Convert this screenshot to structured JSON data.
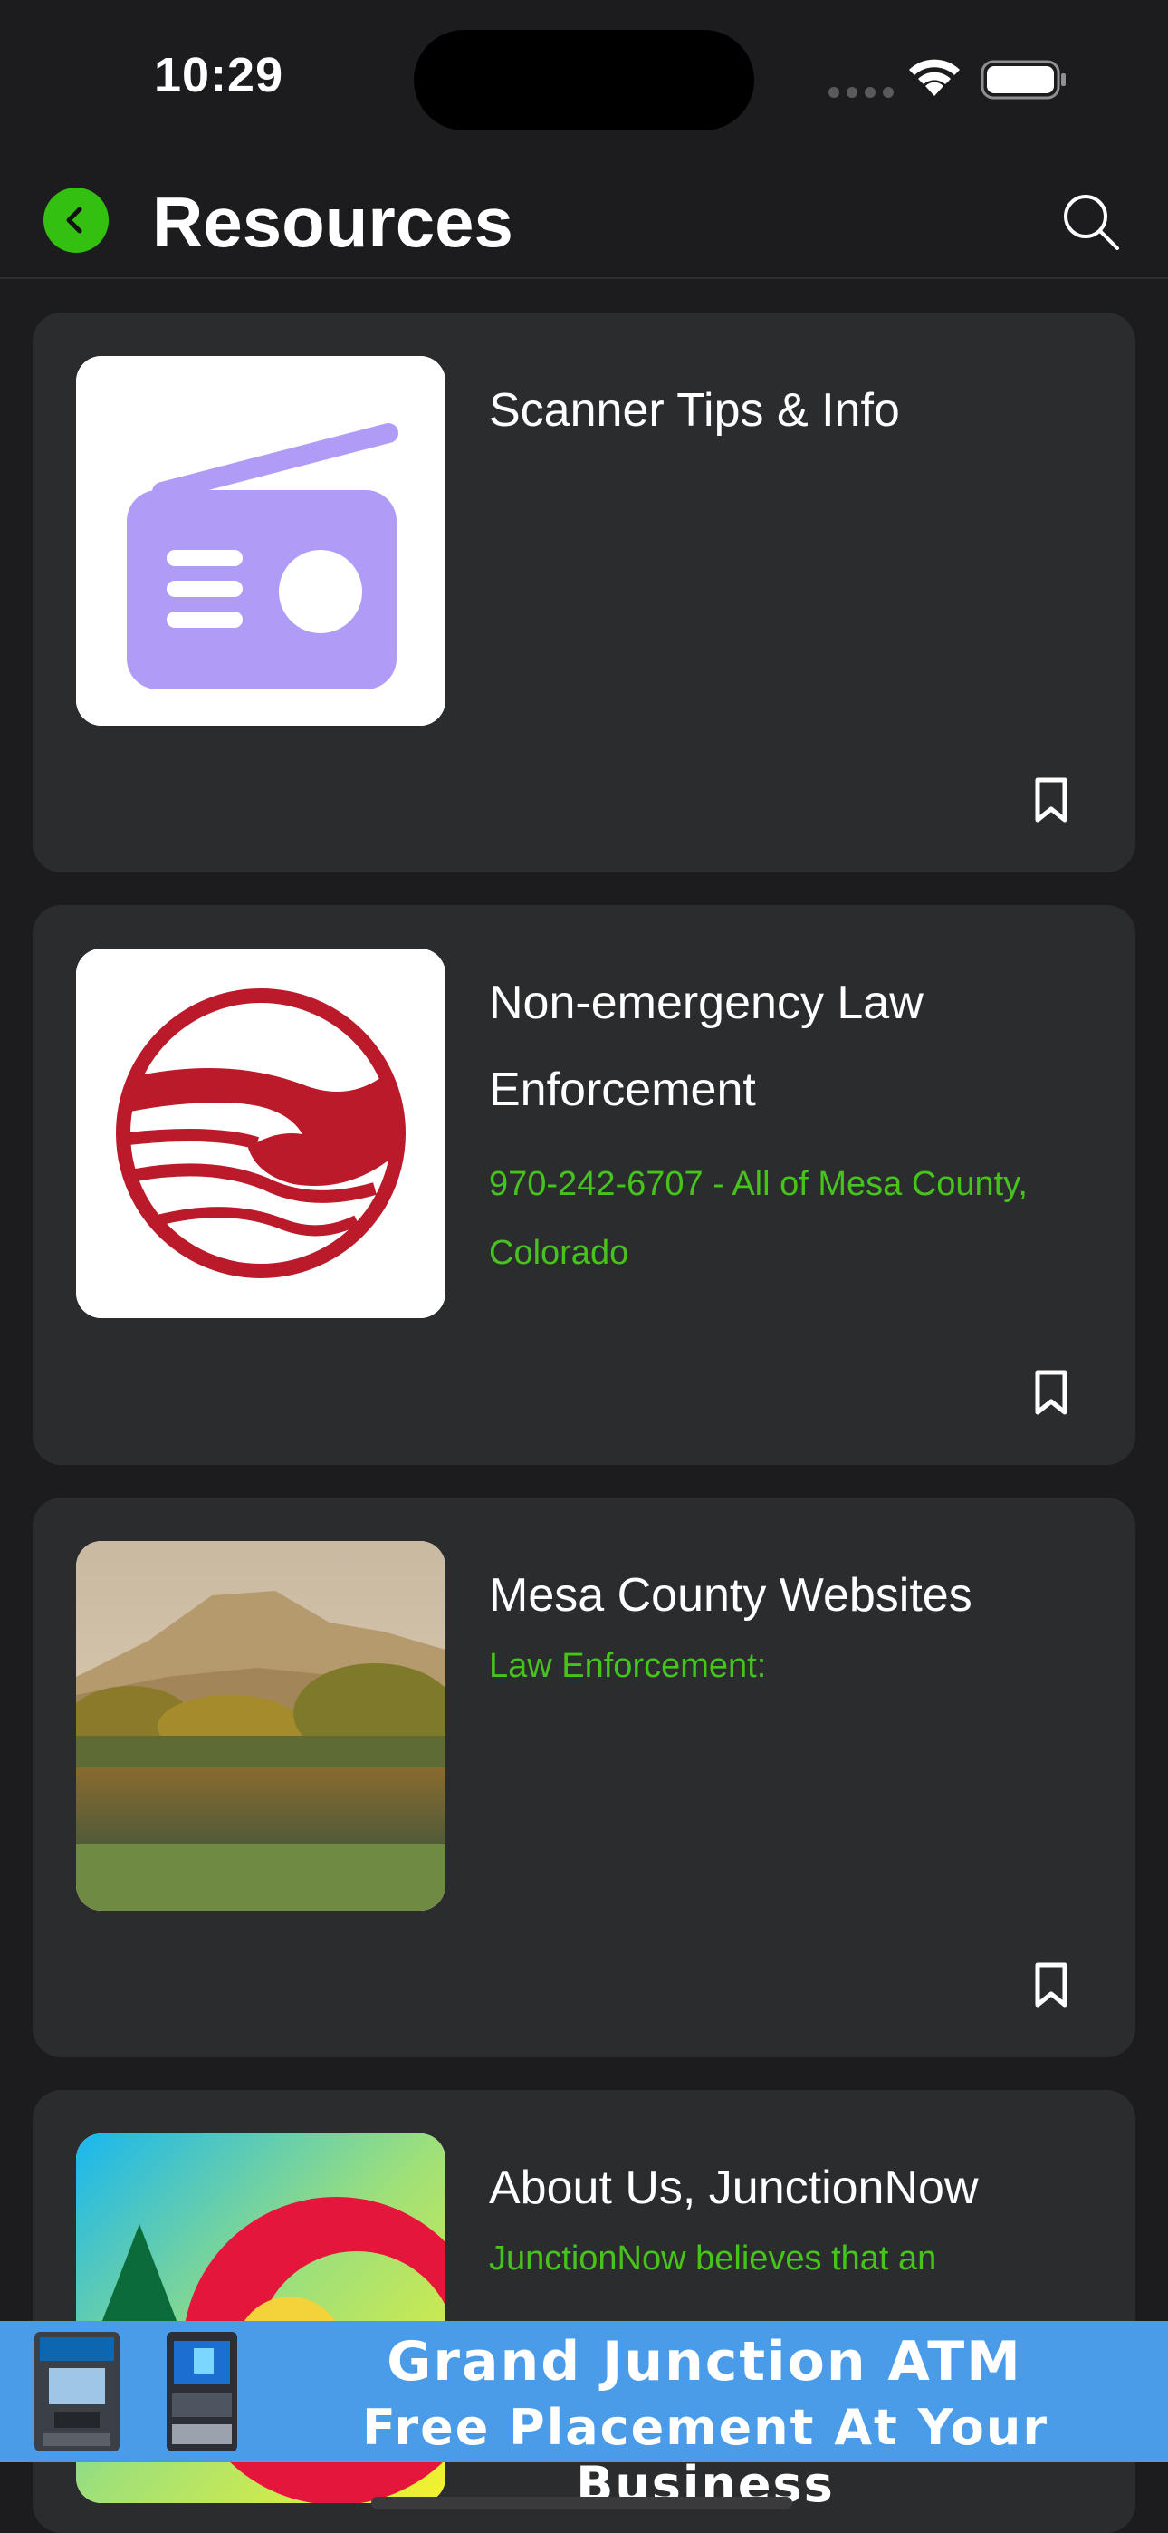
{
  "status_bar": {
    "time": "10:29"
  },
  "header": {
    "title": "Resources"
  },
  "cards": [
    {
      "title": "Scanner Tips & Info",
      "subtitle": "",
      "image": "radio-icon"
    },
    {
      "title": "Non-emergency Law Enforcement",
      "subtitle": "970-242-6707 - All of Mesa County, Colorado",
      "image": "colorado-c-logo"
    },
    {
      "title": "Mesa County Websites",
      "subtitle": "Law Enforcement:",
      "image": "mesa-landscape-photo"
    },
    {
      "title": "About Us, JunctionNow",
      "subtitle": "JunctionNow believes that an",
      "image": "junctionnow-logo"
    }
  ],
  "ad": {
    "line1": "Grand Junction ATM",
    "line2": "Free Placement At Your Business"
  },
  "colors": {
    "accent": "#34c011",
    "link": "#46c41c",
    "card": "#2b2c2e",
    "background": "#1c1c1e",
    "ad_background": "#4a9be8"
  }
}
